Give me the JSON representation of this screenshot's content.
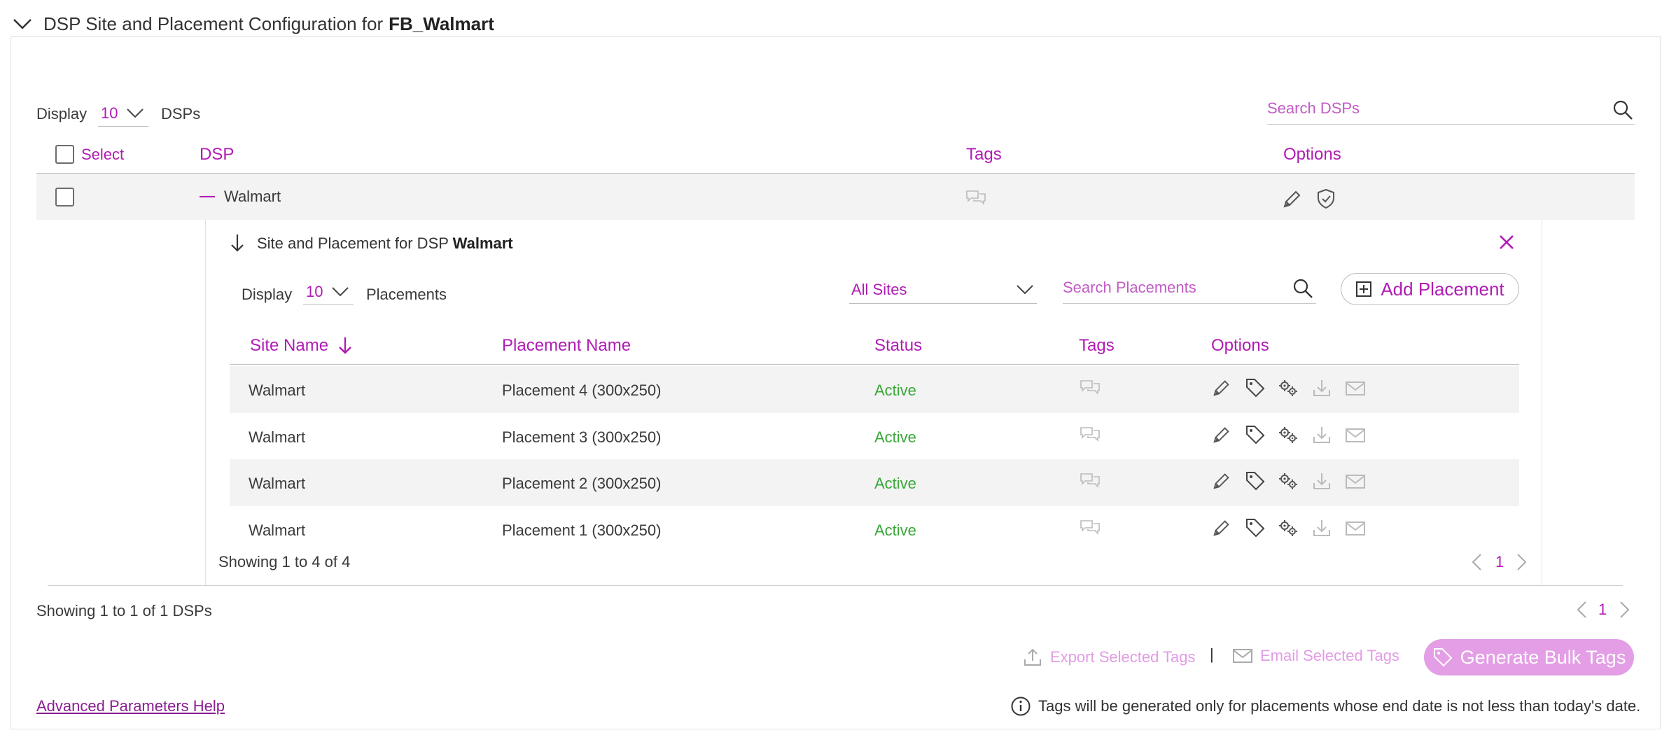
{
  "section": {
    "title_prefix": "DSP Site and Placement Configuration for",
    "title_bold": "FB_Walmart"
  },
  "dsp_table": {
    "display_label": "Display",
    "display_value": "10",
    "display_suffix": "DSPs",
    "search_placeholder": "Search DSPs",
    "columns": {
      "select": "Select",
      "dsp": "DSP",
      "tags": "Tags",
      "options": "Options"
    },
    "rows": [
      {
        "dsp": "Walmart"
      }
    ],
    "showing": "Showing 1 to 1 of 1 DSPs",
    "page": "1"
  },
  "placements": {
    "title_prefix": "Site and Placement for DSP",
    "title_bold": "Walmart",
    "display_label": "Display",
    "display_value": "10",
    "display_suffix": "Placements",
    "site_filter": "All Sites",
    "search_placeholder": "Search Placements",
    "add_button": "Add Placement",
    "columns": {
      "site": "Site Name",
      "placement": "Placement Name",
      "status": "Status",
      "tags": "Tags",
      "options": "Options"
    },
    "rows": [
      {
        "site": "Walmart",
        "placement": "Placement 4 (300x250)",
        "status": "Active"
      },
      {
        "site": "Walmart",
        "placement": "Placement 3 (300x250)",
        "status": "Active"
      },
      {
        "site": "Walmart",
        "placement": "Placement 2 (300x250)",
        "status": "Active"
      },
      {
        "site": "Walmart",
        "placement": "Placement 1 (300x250)",
        "status": "Active"
      }
    ],
    "showing": "Showing 1 to 4 of 4",
    "page": "1"
  },
  "footer": {
    "export_label": "Export Selected Tags",
    "separator": "|",
    "email_label": "Email Selected Tags",
    "generate_label": "Generate Bulk Tags",
    "help_link": "Advanced Parameters Help",
    "info_text": "Tags will be generated only for placements whose end date is not less than today's date."
  },
  "colors": {
    "accent": "#b01cb4",
    "active": "#3aa63a",
    "button_disabled": "#e39ee6"
  }
}
